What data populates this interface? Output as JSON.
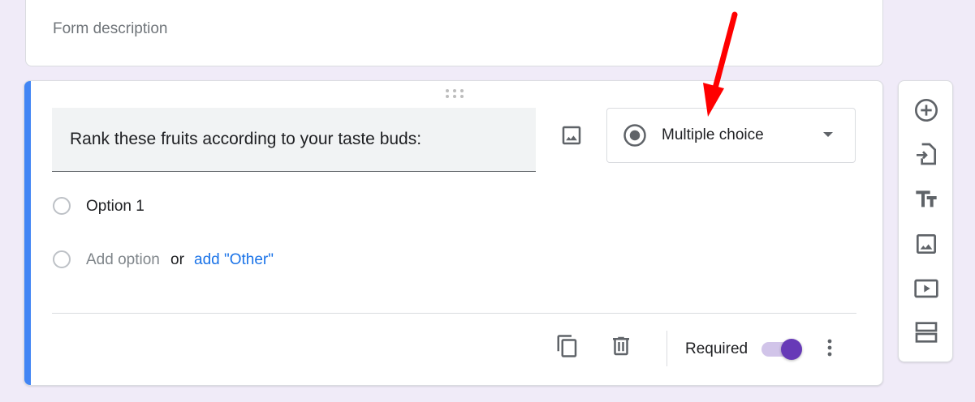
{
  "form": {
    "description_placeholder": "Form description"
  },
  "question": {
    "title": "Rank these fruits according to your taste buds:",
    "type_label": "Multiple choice",
    "options": [
      {
        "label": "Option 1"
      }
    ],
    "add_option_label": "Add option",
    "or_label": "or",
    "add_other_label": "add \"Other\"",
    "required_label": "Required",
    "required": true
  },
  "toolbar": {
    "icons": [
      "add-question-icon",
      "import-questions-icon",
      "add-title-icon",
      "add-image-icon",
      "add-video-icon",
      "add-section-icon"
    ]
  },
  "colors": {
    "background": "#f0ebf8",
    "accent_blue": "#4285f4",
    "toggle_purple": "#673ab7",
    "link_blue": "#1a73e8",
    "annotation_arrow": "#ff0000"
  }
}
